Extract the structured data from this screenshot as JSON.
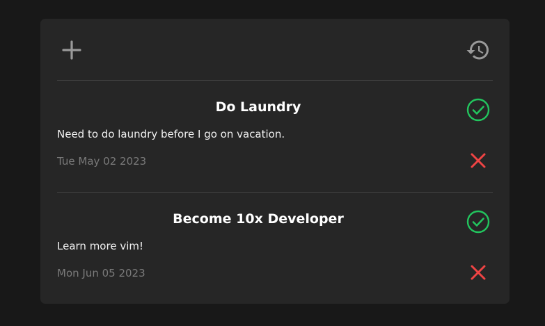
{
  "toolbar": {
    "add_icon": "plus-icon",
    "history_icon": "history-icon"
  },
  "todos": [
    {
      "title": "Do Laundry",
      "description": "Need to do laundry before I go on vacation.",
      "date": "Tue May 02 2023",
      "complete_icon": "check-circle-icon",
      "delete_icon": "close-icon"
    },
    {
      "title": "Become 10x Developer",
      "description": "Learn more vim!",
      "date": "Mon Jun 05 2023",
      "complete_icon": "check-circle-icon",
      "delete_icon": "close-icon"
    }
  ],
  "colors": {
    "background": "#181818",
    "card": "#262626",
    "success": "#22c55e",
    "danger": "#ef4444",
    "muted": "#7a7a7a",
    "icon": "#9a9a9a"
  }
}
